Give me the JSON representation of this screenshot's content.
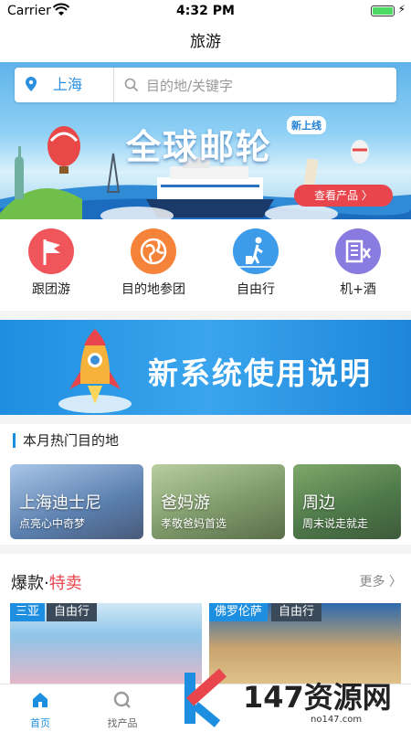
{
  "status_bar": {
    "carrier": "Carrier",
    "time": "4:32 PM",
    "battery_level": 1.0
  },
  "nav": {
    "title": "旅游"
  },
  "search": {
    "city": "上海",
    "placeholder": "目的地/关键字"
  },
  "banner": {
    "title": "全球邮轮",
    "badge": "新上线",
    "cta": "查看产品 〉"
  },
  "categories": [
    {
      "label": "跟团游",
      "icon": "flag-icon",
      "color": "#f0555c"
    },
    {
      "label": "目的地参团",
      "icon": "globe-icon",
      "color": "#f5843a"
    },
    {
      "label": "自由行",
      "icon": "traveler-icon",
      "color": "#3d9be9"
    },
    {
      "label": "机+酒",
      "icon": "hotel-icon",
      "color": "#8a7be0"
    }
  ],
  "promo": {
    "text": "新系统使用说明"
  },
  "popular": {
    "header": "本月热门目的地",
    "items": [
      {
        "title": "上海迪士尼",
        "subtitle": "点亮心中奇梦"
      },
      {
        "title": "爸妈游",
        "subtitle": "孝敬爸妈首选"
      },
      {
        "title": "周边",
        "subtitle": "周末说走就走"
      }
    ]
  },
  "hot": {
    "title_prefix": "爆款·",
    "title_highlight": "特卖",
    "more": "更多",
    "cards": [
      {
        "place": "三亚",
        "type": "自由行"
      },
      {
        "place": "佛罗伦萨",
        "type": "自由行"
      }
    ]
  },
  "tabbar": {
    "items": [
      {
        "label": "首页",
        "icon": "home-icon"
      },
      {
        "label": "找产品",
        "icon": "search-icon"
      }
    ]
  },
  "watermark": {
    "text": "147资源网",
    "sub": "no147.com"
  },
  "colors": {
    "accent": "#1e8fe0",
    "sale": "#e8454c"
  }
}
